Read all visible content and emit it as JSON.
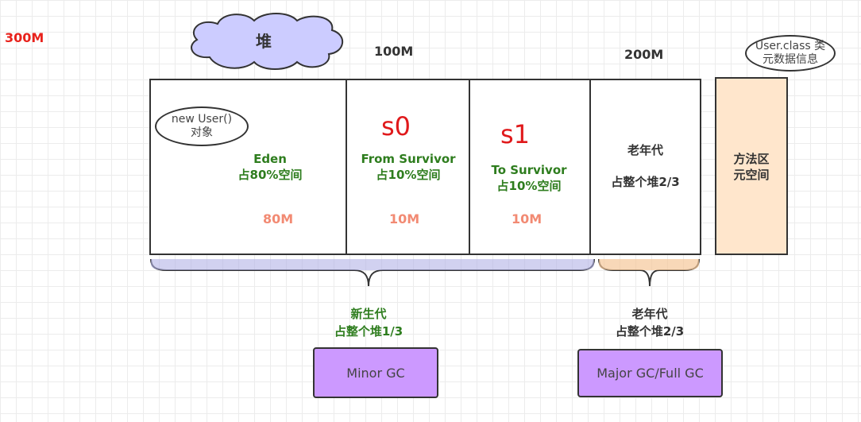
{
  "total_size": "300M",
  "heap_label": "堆",
  "young_size": "100M",
  "old_size_top": "200M",
  "metaspace_note": {
    "line1": "User.class 类",
    "line2": "元数据信息"
  },
  "new_user_note": {
    "line1": "new User()",
    "line2": "对象"
  },
  "eden": {
    "title": "Eden",
    "ratio": "占80%空间",
    "size": "80M"
  },
  "from_survivor": {
    "tag": "s0",
    "title": "From Survivor",
    "ratio": "占10%空间",
    "size": "10M"
  },
  "to_survivor": {
    "tag": "s1",
    "title": "To Survivor",
    "ratio": "占10%空间",
    "size": "10M"
  },
  "old_box": {
    "title": "老年代",
    "ratio": "占整个堆2/3"
  },
  "method_area": {
    "line1": "方法区",
    "line2": "元空间"
  },
  "young_gen": {
    "title": "新生代",
    "ratio": "占整个堆1/3"
  },
  "old_gen": {
    "title": "老年代",
    "ratio": "占整个堆2/3"
  },
  "minor_gc": "Minor GC",
  "major_gc": "Major GC/Full GC",
  "colors": {
    "red": "#e8221c",
    "green": "#2e7d1e",
    "salmon": "#f28a73",
    "cloud": "#ccccff",
    "method_area": "#ffe6cc",
    "gc_button": "#cc99ff",
    "young_brace": "#b3b3e6",
    "old_brace": "#f5c89a"
  }
}
